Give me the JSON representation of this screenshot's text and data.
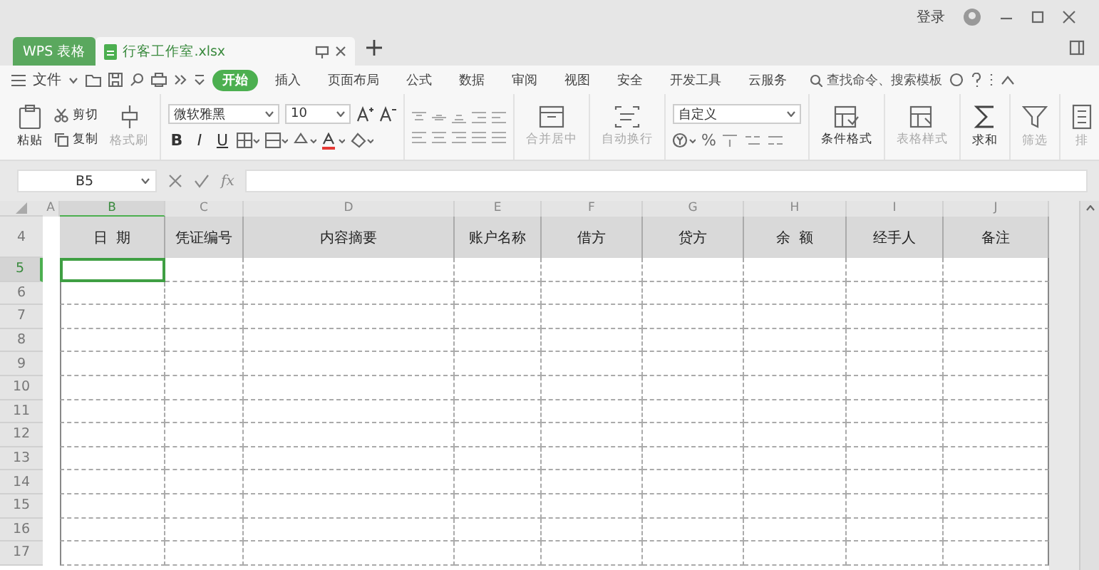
{
  "window": {
    "app_tab": "WPS 表格",
    "doc_tab": "行客工作室.xlsx",
    "login": "登录"
  },
  "menu": {
    "file": "文件",
    "tabs": [
      {
        "label": "开始",
        "selected": true
      },
      {
        "label": "插入",
        "selected": false
      },
      {
        "label": "页面布局",
        "selected": false
      },
      {
        "label": "公式",
        "selected": false
      },
      {
        "label": "数据",
        "selected": false
      },
      {
        "label": "审阅",
        "selected": false
      },
      {
        "label": "视图",
        "selected": false
      },
      {
        "label": "安全",
        "selected": false
      },
      {
        "label": "开发工具",
        "selected": false
      },
      {
        "label": "云服务",
        "selected": false
      }
    ],
    "search": {
      "placeholder": "查找命令、搜索模板"
    }
  },
  "ribbon": {
    "paste": "粘贴",
    "cut": "剪切",
    "copy": "复制",
    "format_painter": {
      "label": "格式刷",
      "disabled": true
    },
    "font_name": "微软雅黑",
    "font_size": "10",
    "style_buttons": [
      {
        "kind": "bold",
        "label": "B"
      },
      {
        "kind": "italic",
        "label": "I"
      },
      {
        "kind": "underline",
        "label": "U"
      }
    ],
    "number_format": "自定义",
    "percent": "%",
    "large_buttons": [
      {
        "kind": "merge",
        "label": "合并居中",
        "disabled": true
      },
      {
        "kind": "wrap",
        "label": "自动换行",
        "disabled": true
      },
      {
        "kind": "conditional",
        "label": "条件格式",
        "disabled": false
      },
      {
        "kind": "table_style",
        "label": "表格样式",
        "disabled": true
      },
      {
        "kind": "sum",
        "label": "求和",
        "disabled": false
      },
      {
        "kind": "filter",
        "label": "筛选",
        "disabled": true
      },
      {
        "kind": "sort",
        "label": "排",
        "disabled": true
      }
    ]
  },
  "formula_bar": {
    "name_box": "B5",
    "fx": "fx"
  },
  "sheet": {
    "columns": [
      {
        "letter": "A",
        "selected": false
      },
      {
        "letter": "B",
        "selected": true
      },
      {
        "letter": "C",
        "selected": false
      },
      {
        "letter": "D",
        "selected": false
      },
      {
        "letter": "E",
        "selected": false
      },
      {
        "letter": "F",
        "selected": false
      },
      {
        "letter": "G",
        "selected": false
      },
      {
        "letter": "H",
        "selected": false
      },
      {
        "letter": "I",
        "selected": false
      },
      {
        "letter": "J",
        "selected": false
      }
    ],
    "header_row": {
      "number": "4",
      "cells": [
        "日  期",
        "凭证编号",
        "内容摘要",
        "账户名称",
        "借方",
        "贷方",
        "余  额",
        "经手人",
        "备注"
      ]
    },
    "rows": [
      {
        "number": "5",
        "selected": true
      },
      {
        "number": "6",
        "selected": false
      },
      {
        "number": "7",
        "selected": false
      },
      {
        "number": "8",
        "selected": false
      },
      {
        "number": "9",
        "selected": false
      },
      {
        "number": "10",
        "selected": false
      },
      {
        "number": "11",
        "selected": false
      },
      {
        "number": "12",
        "selected": false
      },
      {
        "number": "13",
        "selected": false
      },
      {
        "number": "14",
        "selected": false
      },
      {
        "number": "15",
        "selected": false
      },
      {
        "number": "16",
        "selected": false
      },
      {
        "number": "17",
        "selected": false
      }
    ]
  }
}
